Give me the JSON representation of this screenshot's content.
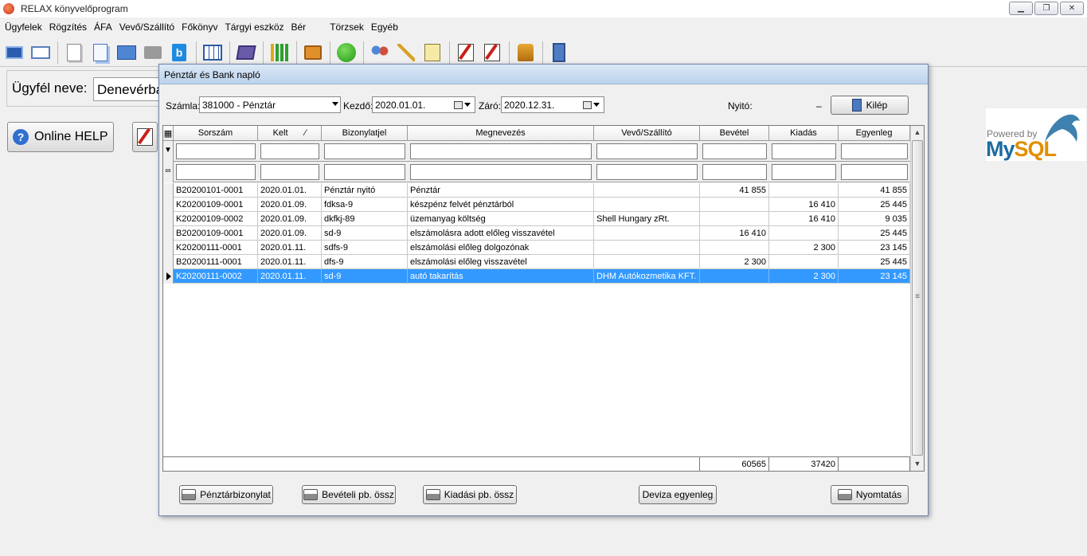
{
  "app": {
    "title": "RELAX könyvelőprogram"
  },
  "menu": [
    "Ügyfelek",
    "Rögzítés",
    "ÁFA",
    "Vevő/Szállító",
    "Főkönyv",
    "Tárgyi eszköz",
    "Bér",
    "Törzsek",
    "Egyéb"
  ],
  "toolbar_icons": [
    "client-card-icon",
    "envelope-icon",
    "document-icon",
    "documents-icon",
    "table-icon",
    "grey-card-icon",
    "b-icon",
    "grid-icon",
    "book-icon",
    "bar-chart-icon",
    "ledger-icon",
    "smiley-icon",
    "people-icon",
    "wand-icon",
    "note-pen-icon",
    "edit-pen-icon",
    "edit-pen-icon-2",
    "joystick-icon",
    "exit-door-icon"
  ],
  "client": {
    "label": "Ügyfél neve:",
    "value": "Denevérba"
  },
  "help": {
    "label": "Online HELP"
  },
  "mysql": {
    "powered": "Powered by",
    "my": "My",
    "sql": "SQL"
  },
  "dialog": {
    "title": "Pénztár és Bank napló",
    "account_label": "Számla:",
    "account_value": "381000 - Pénztár",
    "start_label": "Kezdő:",
    "start_value": "2020.01.01.",
    "end_label": "Záró:",
    "end_value": "2020.12.31.",
    "opening_label": "Nyitó:",
    "opening_value": "–",
    "exit_label": "Kilép"
  },
  "table": {
    "columns": [
      "Sorszám",
      "Kelt",
      "Bizonylatjel",
      "Megnevezés",
      "Vevő/Szállító",
      "Bevétel",
      "Kiadás",
      "Egyenleg"
    ],
    "rows": [
      [
        "B20200101-0001",
        "2020.01.01.",
        "Pénztár nyitó",
        "Pénztár",
        "",
        "41 855",
        "",
        "41 855"
      ],
      [
        "K20200109-0001",
        "2020.01.09.",
        "fdksa-9",
        "készpénz felvét pénztárból",
        "",
        "",
        "16 410",
        "25 445"
      ],
      [
        "K20200109-0002",
        "2020.01.09.",
        "dkfkj-89",
        "üzemanyag költség",
        "Shell Hungary zRt.",
        "",
        "16 410",
        "9 035"
      ],
      [
        "B20200109-0001",
        "2020.01.09.",
        "sd-9",
        "elszámolásra adott előleg visszavétel",
        "",
        "16 410",
        "",
        "25 445"
      ],
      [
        "K20200111-0001",
        "2020.01.11.",
        "sdfs-9",
        "elszámolási előleg dolgozónak",
        "",
        "",
        "2 300",
        "23 145"
      ],
      [
        "B20200111-0001",
        "2020.01.11.",
        "dfs-9",
        "elszámolási előleg visszavétel",
        "",
        "2 300",
        "",
        "25 445"
      ],
      [
        "K20200111-0002",
        "2020.01.11.",
        "sd-9",
        "autó takarítás",
        "DHM Autókozmetika KFT.",
        "",
        "2 300",
        "23 145"
      ]
    ],
    "selected_row": 6,
    "totals": {
      "income": "60565",
      "expense": "37420"
    }
  },
  "buttons": {
    "receipt": "Pénztárbizonylat",
    "income_summary": "Bevételi pb. össz",
    "expense_summary": "Kiadási pb. össz",
    "currency_balance": "Deviza egyenleg",
    "print": "Nyomtatás"
  },
  "colors": {
    "selection": "#3399ff",
    "dialog_title": "#bcd2ec"
  }
}
